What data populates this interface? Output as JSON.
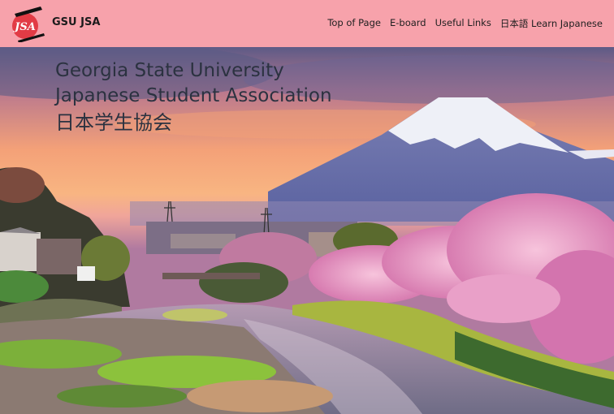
{
  "header": {
    "logo_text": "JSA",
    "site_name": "GSU JSA",
    "nav": [
      "Top of Page",
      "E-board",
      "Useful Links",
      "日本語 Learn Japanese"
    ]
  },
  "hero": {
    "title_line1": "Georgia State University",
    "title_line2": "Japanese Student Association",
    "title_line3": "日本学生協会",
    "image": "mount-fuji-cherry-blossom-river"
  },
  "colors": {
    "nav_bg": "#f7a2ab",
    "logo_red": "#e23b45",
    "title_text": "#2b3240"
  }
}
